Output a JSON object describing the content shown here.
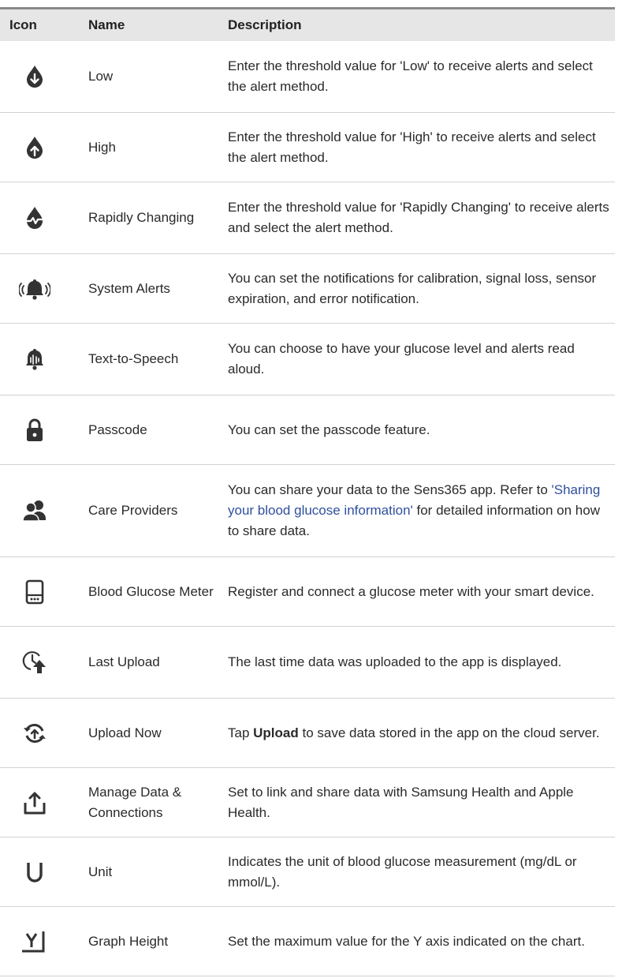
{
  "header": {
    "icon": "Icon",
    "name": "Name",
    "description": "Description"
  },
  "rows": [
    {
      "icon": "drop-down-arrow-icon",
      "name": "Low",
      "desc": "Enter the threshold value for 'Low' to receive alerts and select the alert method."
    },
    {
      "icon": "drop-up-arrow-icon",
      "name": "High",
      "desc": "Enter the threshold value for 'High' to receive alerts and select the alert method."
    },
    {
      "icon": "drop-pulse-icon",
      "name": "Rapidly Changing",
      "desc": "Enter the threshold value for 'Rapidly Changing' to receive alerts and select the alert method."
    },
    {
      "icon": "ringing-bell-icon",
      "name": "System Alerts",
      "desc": "You can set the notifications for calibration, signal loss, sensor expiration, and error notification."
    },
    {
      "icon": "speaking-bell-icon",
      "name": "Text-to-Speech",
      "desc": "You can choose to have your glucose level and alerts read aloud."
    },
    {
      "icon": "lock-icon",
      "name": "Passcode",
      "desc": "You can set the passcode feature."
    },
    {
      "icon": "people-icon",
      "name": "Care Providers",
      "desc_pre": "You can share your data to the Sens365 app. Refer to ",
      "desc_link": "'Sharing your blood glucose information'",
      "desc_post": " for detailed information on how to share data."
    },
    {
      "icon": "glucose-meter-icon",
      "name": "Blood Glucose Meter",
      "desc": "Register and connect a glucose meter with your smart device."
    },
    {
      "icon": "clock-upload-icon",
      "name": "Last Upload",
      "desc": "The last time data was uploaded to the app is displayed."
    },
    {
      "icon": "sync-icon",
      "name": "Upload Now",
      "desc_pre": "Tap ",
      "desc_bold": "Upload",
      "desc_post": " to save data stored in the app on the cloud server."
    },
    {
      "icon": "share-upload-icon",
      "name": "Manage Data & Connections",
      "desc": "Set to link and share data with Samsung Health and Apple Health."
    },
    {
      "icon": "unit-u-icon",
      "name": "Unit",
      "desc": "Indicates the unit of blood glucose measurement (mg/dL or mmol/L)."
    },
    {
      "icon": "y-axis-icon",
      "name": "Graph Height",
      "desc": "Set the maximum value for the Y axis indicated on the chart."
    }
  ],
  "colors": {
    "icon": "#333333",
    "link": "#2f4f9e",
    "header_bg": "#e6e6e6",
    "rule": "#d2d2d2"
  }
}
